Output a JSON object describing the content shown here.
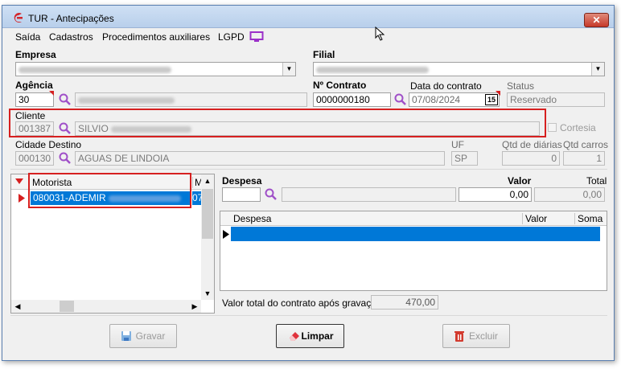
{
  "window": {
    "title": "TUR - Antecipações",
    "close_label": "✕"
  },
  "menu": {
    "items": [
      "Saída",
      "Cadastros",
      "Procedimentos auxiliares",
      "LGPD"
    ]
  },
  "empresa": {
    "label": "Empresa"
  },
  "filial": {
    "label": "Filial"
  },
  "agencia": {
    "label": "Agência",
    "code": "30"
  },
  "contrato": {
    "label": "Nº Contrato",
    "value": "0000000180"
  },
  "data_contrato": {
    "label": "Data do contrato",
    "value": "07/08/2024",
    "calendar_label": "15"
  },
  "status": {
    "label": "Status",
    "value": "Reservado"
  },
  "cliente": {
    "label": "Cliente",
    "code": "001387",
    "name": "SILVIO",
    "cortesia_label": "Cortesia"
  },
  "cidade": {
    "label": "Cidade Destino",
    "code": "000130",
    "name": "AGUAS DE LINDOIA"
  },
  "uf": {
    "label": "UF",
    "value": "SP"
  },
  "qtd_diarias": {
    "label": "Qtd de diárias",
    "value": "0"
  },
  "qtd_carros": {
    "label": "Qtd carros",
    "value": "1"
  },
  "motorista_grid": {
    "col_motorista": "Motorista",
    "col_m": "M",
    "row_value": "080031-ADEMIR",
    "row_m": "07"
  },
  "despesa": {
    "label": "Despesa",
    "valor_label": "Valor",
    "total_label": "Total",
    "valor": "0,00",
    "total": "0,00"
  },
  "despesa_grid": {
    "col_despesa": "Despesa",
    "col_valor": "Valor",
    "col_soma": "Soma"
  },
  "valor_total": {
    "label": "Valor total do contrato após gravação",
    "value": "470,00"
  },
  "buttons": {
    "gravar": "Gravar",
    "limpar": "Limpar",
    "excluir": "Excluir"
  },
  "colors": {
    "selection": "#0078d7",
    "highlight_frame": "#d62020"
  }
}
